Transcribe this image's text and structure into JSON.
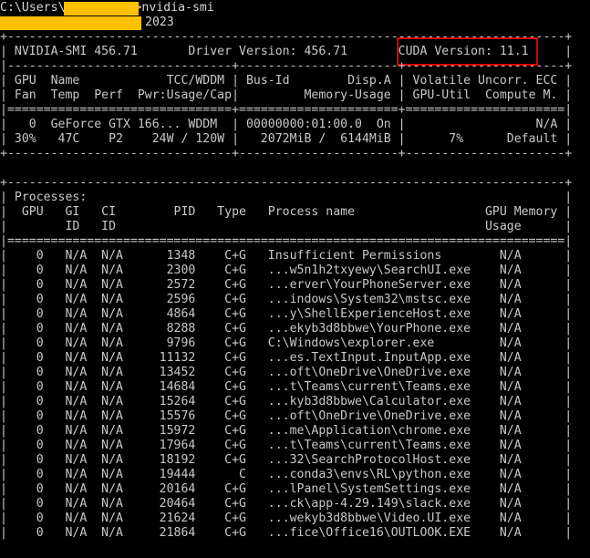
{
  "window": {
    "prompt_prefix": "C:\\Users\\",
    "prompt_suffix": ">nvidia-smi",
    "second_line_tail": "2023",
    "redaction_color": "#ffc000",
    "highlight_color": "#e00000",
    "text_color": "#c8c8c8",
    "background": "#000000"
  },
  "summary": {
    "border_top": "+-----------------------------------------------------------------------------+",
    "title_line": "| NVIDIA-SMI 456.71       Driver Version: 456.71       CUDA Version: 11.1     |",
    "highlighted_text": "CUDA Version: 11.1"
  },
  "gpu_table": {
    "sep_dash": "|-------------------------------+----------------------+----------------------+",
    "header_1": "| GPU  Name            TCC/WDDM | Bus-Id        Disp.A | Volatile Uncorr. ECC |",
    "header_2": "| Fan  Temp  Perf  Pwr:Usage/Cap|         Memory-Usage | GPU-Util  Compute M. |",
    "sep_eq": "|===============================+======================+======================|",
    "row_1": "|   0  GeForce GTX 166... WDDM  | 00000000:01:00.0  On |                  N/A |",
    "row_2": "| 30%   47C    P2    24W / 120W |   2072MiB /  6144MiB |      7%      Default |",
    "border_bottom": "+-------------------------------+----------------------+----------------------+"
  },
  "processes": {
    "border_top": "+-----------------------------------------------------------------------------+",
    "title": "| Processes:                                                                  |",
    "header_1": "|  GPU   GI   CI        PID   Type   Process name                  GPU Memory |",
    "header_2": "|        ID   ID                                                   Usage      |",
    "sep_eq": "|=============================================================================|",
    "rows": [
      "|    0   N/A  N/A      1348    C+G   Insufficient Permissions        N/A      |",
      "|    0   N/A  N/A      2300    C+G   ...w5n1h2txyewy\\SearchUI.exe    N/A      |",
      "|    0   N/A  N/A      2572    C+G   ...erver\\YourPhoneServer.exe    N/A      |",
      "|    0   N/A  N/A      2596    C+G   ...indows\\System32\\mstsc.exe    N/A      |",
      "|    0   N/A  N/A      4864    C+G   ...y\\ShellExperienceHost.exe    N/A      |",
      "|    0   N/A  N/A      8288    C+G   ...ekyb3d8bbwe\\YourPhone.exe    N/A      |",
      "|    0   N/A  N/A      9796    C+G   C:\\Windows\\explorer.exe         N/A      |",
      "|    0   N/A  N/A     11132    C+G   ...es.TextInput.InputApp.exe    N/A      |",
      "|    0   N/A  N/A     13452    C+G   ...oft\\OneDrive\\OneDrive.exe    N/A      |",
      "|    0   N/A  N/A     14684    C+G   ...t\\Teams\\current\\Teams.exe    N/A      |",
      "|    0   N/A  N/A     15264    C+G   ...kyb3d8bbwe\\Calculator.exe    N/A      |",
      "|    0   N/A  N/A     15576    C+G   ...oft\\OneDrive\\OneDrive.exe    N/A      |",
      "|    0   N/A  N/A     15972    C+G   ...me\\Application\\chrome.exe    N/A      |",
      "|    0   N/A  N/A     17964    C+G   ...t\\Teams\\current\\Teams.exe    N/A      |",
      "|    0   N/A  N/A     18192    C+G   ...32\\SearchProtocolHost.exe    N/A      |",
      "|    0   N/A  N/A     19444      C   ...conda3\\envs\\RL\\python.exe    N/A      |",
      "|    0   N/A  N/A     20164    C+G   ...lPanel\\SystemSettings.exe    N/A      |",
      "|    0   N/A  N/A     20464    C+G   ...ck\\app-4.29.149\\slack.exe    N/A      |",
      "|    0   N/A  N/A     21624    C+G   ...wekyb3d8bbwe\\Video.UI.exe    N/A      |",
      "|    0   N/A  N/A     21864    C+G   ...fice\\Office16\\OUTLOOK.EXE    N/A      |"
    ]
  }
}
